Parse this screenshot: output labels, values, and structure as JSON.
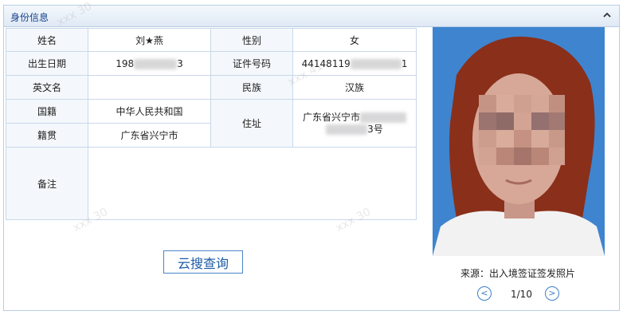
{
  "panel": {
    "title": "身份信息",
    "collapse_icon": "chevron-up-icon"
  },
  "fields": {
    "name_label": "姓名",
    "name_value": "刘★燕",
    "gender_label": "性别",
    "gender_value": "女",
    "birth_label": "出生日期",
    "birth_value_prefix": "198",
    "birth_value_suffix": "3",
    "id_label": "证件号码",
    "id_value_prefix": "44148119",
    "id_value_suffix": "1",
    "english_name_label": "英文名",
    "english_name_value": "",
    "ethnicity_label": "民族",
    "ethnicity_value": "汉族",
    "nationality_label": "国籍",
    "nationality_value": "中华人民共和国",
    "address_label": "住址",
    "address_line1": "广东省兴宁市",
    "address_line2_suffix": "3号",
    "native_place_label": "籍贯",
    "native_place_value": "广东省兴宁市",
    "remarks_label": "备注",
    "remarks_value": ""
  },
  "actions": {
    "cloud_search_label": "云搜查询"
  },
  "photo": {
    "source_text": "来源：出入境签证签发照片",
    "page_indicator": "1/10",
    "prev_label": "<",
    "next_label": ">"
  },
  "colors": {
    "header_text": "#15428b",
    "border": "#c8d8ea",
    "button_border": "#4a86c8",
    "photo_background": "#3f84cf"
  }
}
